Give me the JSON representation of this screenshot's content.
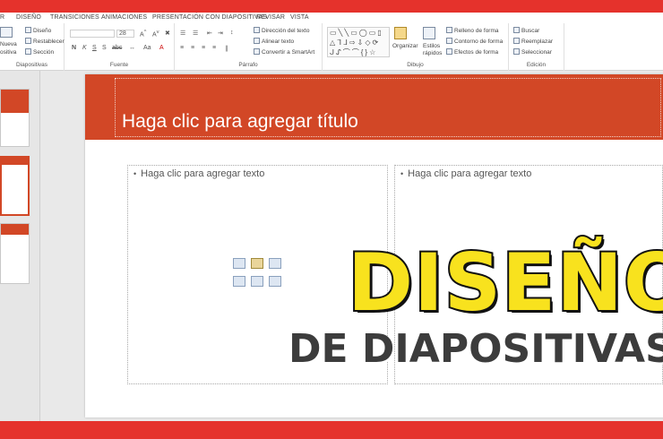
{
  "menu_tabs": [
    "R",
    "DISEÑO",
    "TRANSICIONES",
    "ANIMACIONES",
    "PRESENTACIÓN CON DIAPOSITIVAS",
    "REVISAR",
    "VISTA"
  ],
  "ribbon": {
    "diapositivas": {
      "new_slide": "Nueva",
      "new_slide_2": "ositiva",
      "layout": "Diseño",
      "reset": "Restablecer",
      "section": "Sección",
      "title": "Diapositivas"
    },
    "fuente": {
      "size": "28",
      "bold": "N",
      "italic": "K",
      "underline": "S",
      "strike": "abc",
      "title": "Fuente"
    },
    "parrafo": {
      "text_direction": "Dirección del texto",
      "align_text": "Alinear texto",
      "smartart": "Convertir a SmartArt",
      "title": "Párrafo"
    },
    "dibujo": {
      "arrange": "Organizar",
      "quick_styles": "Estilos rápidos",
      "shape_fill": "Relleno de forma",
      "shape_outline": "Contorno de forma",
      "shape_effects": "Efectos de forma",
      "title": "Dibujo"
    },
    "edicion": {
      "find": "Buscar",
      "replace": "Reemplazar",
      "select": "Seleccionar",
      "title": "Edición"
    }
  },
  "slide": {
    "title_placeholder": "Haga clic para agregar título",
    "left_content": "Haga clic para agregar texto",
    "right_content": "Haga clic para agregar texto"
  },
  "overlay": {
    "headline": "DISEÑOS",
    "subheadline": "DE DIAPOSITIVAS"
  },
  "colors": {
    "accent_red": "#d24726",
    "band_red": "#e5322c",
    "headline_yellow": "#f8e21e"
  }
}
